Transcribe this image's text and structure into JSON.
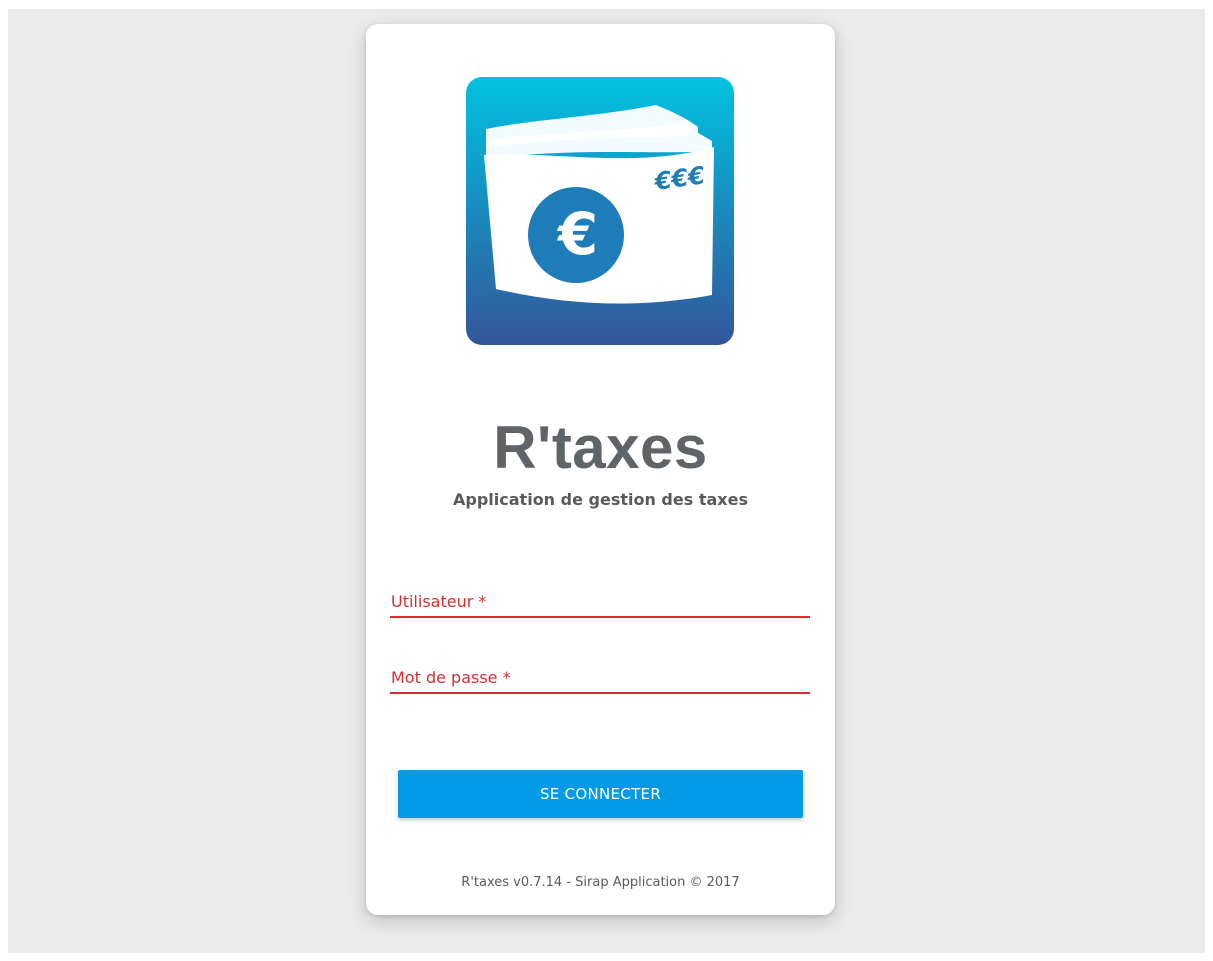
{
  "app": {
    "title": "R'taxes",
    "subtitle": "Application de gestion des taxes"
  },
  "logo": {
    "icon": "euro-banknote-icon",
    "banknote_text": "€€€",
    "symbol": "€",
    "colors": {
      "gradient_top": "#00c2e0",
      "gradient_bottom": "#33559b",
      "coin": "#1e7cb8"
    }
  },
  "form": {
    "username_label": "Utilisateur *",
    "username_value": "",
    "password_label": "Mot de passe *",
    "password_value": "",
    "submit_label": "SE CONNECTER"
  },
  "footer": {
    "text": "R'taxes v0.7.14 - Sirap Application © 2017"
  },
  "colors": {
    "background": "#ebebeb",
    "card": "#ffffff",
    "error": "#d32f2f",
    "primary": "#039be5",
    "title": "#5f6468"
  }
}
